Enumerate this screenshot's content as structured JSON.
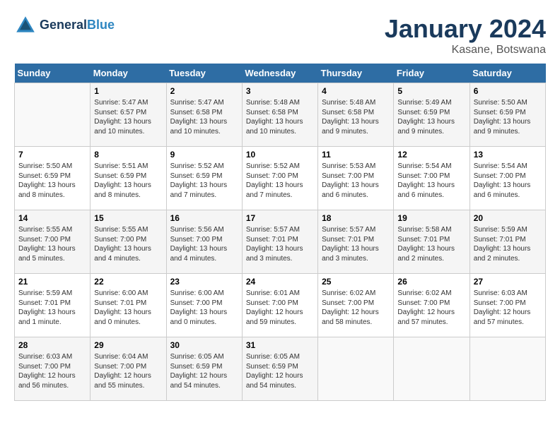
{
  "header": {
    "logo_line1": "General",
    "logo_line2": "Blue",
    "month": "January 2024",
    "location": "Kasane, Botswana"
  },
  "weekdays": [
    "Sunday",
    "Monday",
    "Tuesday",
    "Wednesday",
    "Thursday",
    "Friday",
    "Saturday"
  ],
  "weeks": [
    [
      {
        "day": "",
        "info": ""
      },
      {
        "day": "1",
        "info": "Sunrise: 5:47 AM\nSunset: 6:57 PM\nDaylight: 13 hours\nand 10 minutes."
      },
      {
        "day": "2",
        "info": "Sunrise: 5:47 AM\nSunset: 6:58 PM\nDaylight: 13 hours\nand 10 minutes."
      },
      {
        "day": "3",
        "info": "Sunrise: 5:48 AM\nSunset: 6:58 PM\nDaylight: 13 hours\nand 10 minutes."
      },
      {
        "day": "4",
        "info": "Sunrise: 5:48 AM\nSunset: 6:58 PM\nDaylight: 13 hours\nand 9 minutes."
      },
      {
        "day": "5",
        "info": "Sunrise: 5:49 AM\nSunset: 6:59 PM\nDaylight: 13 hours\nand 9 minutes."
      },
      {
        "day": "6",
        "info": "Sunrise: 5:50 AM\nSunset: 6:59 PM\nDaylight: 13 hours\nand 9 minutes."
      }
    ],
    [
      {
        "day": "7",
        "info": "Sunrise: 5:50 AM\nSunset: 6:59 PM\nDaylight: 13 hours\nand 8 minutes."
      },
      {
        "day": "8",
        "info": "Sunrise: 5:51 AM\nSunset: 6:59 PM\nDaylight: 13 hours\nand 8 minutes."
      },
      {
        "day": "9",
        "info": "Sunrise: 5:52 AM\nSunset: 6:59 PM\nDaylight: 13 hours\nand 7 minutes."
      },
      {
        "day": "10",
        "info": "Sunrise: 5:52 AM\nSunset: 7:00 PM\nDaylight: 13 hours\nand 7 minutes."
      },
      {
        "day": "11",
        "info": "Sunrise: 5:53 AM\nSunset: 7:00 PM\nDaylight: 13 hours\nand 6 minutes."
      },
      {
        "day": "12",
        "info": "Sunrise: 5:54 AM\nSunset: 7:00 PM\nDaylight: 13 hours\nand 6 minutes."
      },
      {
        "day": "13",
        "info": "Sunrise: 5:54 AM\nSunset: 7:00 PM\nDaylight: 13 hours\nand 6 minutes."
      }
    ],
    [
      {
        "day": "14",
        "info": "Sunrise: 5:55 AM\nSunset: 7:00 PM\nDaylight: 13 hours\nand 5 minutes."
      },
      {
        "day": "15",
        "info": "Sunrise: 5:55 AM\nSunset: 7:00 PM\nDaylight: 13 hours\nand 4 minutes."
      },
      {
        "day": "16",
        "info": "Sunrise: 5:56 AM\nSunset: 7:00 PM\nDaylight: 13 hours\nand 4 minutes."
      },
      {
        "day": "17",
        "info": "Sunrise: 5:57 AM\nSunset: 7:01 PM\nDaylight: 13 hours\nand 3 minutes."
      },
      {
        "day": "18",
        "info": "Sunrise: 5:57 AM\nSunset: 7:01 PM\nDaylight: 13 hours\nand 3 minutes."
      },
      {
        "day": "19",
        "info": "Sunrise: 5:58 AM\nSunset: 7:01 PM\nDaylight: 13 hours\nand 2 minutes."
      },
      {
        "day": "20",
        "info": "Sunrise: 5:59 AM\nSunset: 7:01 PM\nDaylight: 13 hours\nand 2 minutes."
      }
    ],
    [
      {
        "day": "21",
        "info": "Sunrise: 5:59 AM\nSunset: 7:01 PM\nDaylight: 13 hours\nand 1 minute."
      },
      {
        "day": "22",
        "info": "Sunrise: 6:00 AM\nSunset: 7:01 PM\nDaylight: 13 hours\nand 0 minutes."
      },
      {
        "day": "23",
        "info": "Sunrise: 6:00 AM\nSunset: 7:00 PM\nDaylight: 13 hours\nand 0 minutes."
      },
      {
        "day": "24",
        "info": "Sunrise: 6:01 AM\nSunset: 7:00 PM\nDaylight: 12 hours\nand 59 minutes."
      },
      {
        "day": "25",
        "info": "Sunrise: 6:02 AM\nSunset: 7:00 PM\nDaylight: 12 hours\nand 58 minutes."
      },
      {
        "day": "26",
        "info": "Sunrise: 6:02 AM\nSunset: 7:00 PM\nDaylight: 12 hours\nand 57 minutes."
      },
      {
        "day": "27",
        "info": "Sunrise: 6:03 AM\nSunset: 7:00 PM\nDaylight: 12 hours\nand 57 minutes."
      }
    ],
    [
      {
        "day": "28",
        "info": "Sunrise: 6:03 AM\nSunset: 7:00 PM\nDaylight: 12 hours\nand 56 minutes."
      },
      {
        "day": "29",
        "info": "Sunrise: 6:04 AM\nSunset: 7:00 PM\nDaylight: 12 hours\nand 55 minutes."
      },
      {
        "day": "30",
        "info": "Sunrise: 6:05 AM\nSunset: 6:59 PM\nDaylight: 12 hours\nand 54 minutes."
      },
      {
        "day": "31",
        "info": "Sunrise: 6:05 AM\nSunset: 6:59 PM\nDaylight: 12 hours\nand 54 minutes."
      },
      {
        "day": "",
        "info": ""
      },
      {
        "day": "",
        "info": ""
      },
      {
        "day": "",
        "info": ""
      }
    ]
  ]
}
